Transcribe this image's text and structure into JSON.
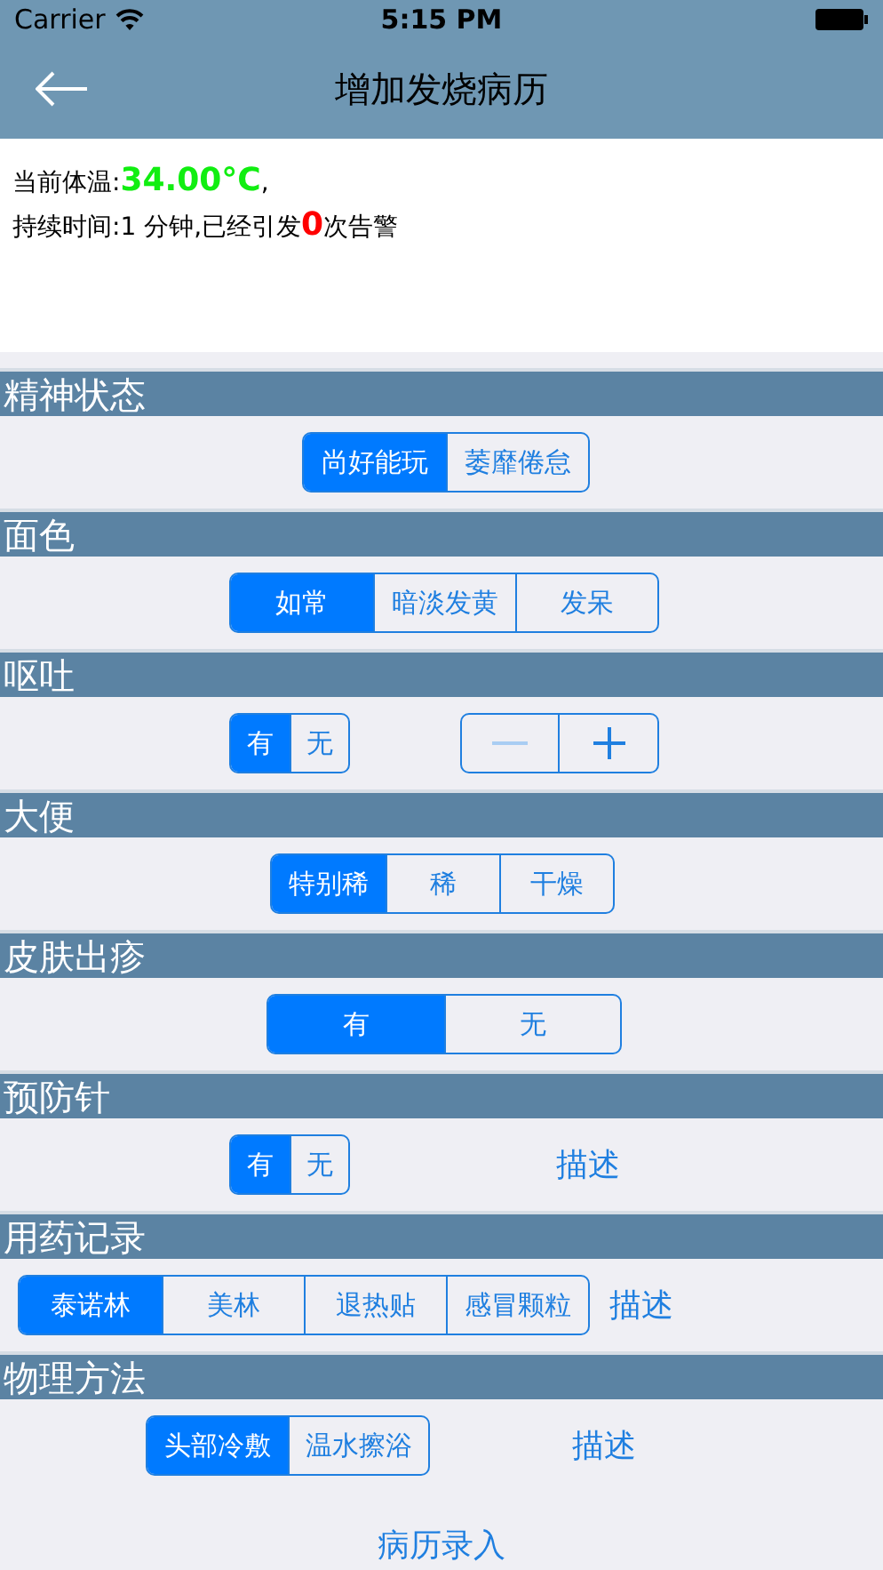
{
  "status_bar": {
    "carrier": "Carrier",
    "time": "5:15 PM"
  },
  "nav_bar": {
    "title": "增加发烧病历"
  },
  "info": {
    "temperature_label": "当前体温:",
    "temperature": "34.00°C",
    "temperature_suffix": ",",
    "duration_prefix": "持续时间:1 分钟,已经引发",
    "alarm_count": "0",
    "duration_suffix": "次告警"
  },
  "sections": [
    {
      "title": "精神状态",
      "controls": [
        {
          "kind": "segmented",
          "options": [
            {
              "label": "尚好能玩",
              "selected": true
            },
            {
              "label": "萎靡倦怠",
              "selected": false
            }
          ]
        }
      ]
    },
    {
      "title": "面色",
      "controls": [
        {
          "kind": "segmented",
          "options": [
            {
              "label": "如常",
              "selected": true
            },
            {
              "label": "暗淡发黄",
              "selected": false
            },
            {
              "label": "发呆",
              "selected": false
            }
          ]
        }
      ]
    },
    {
      "title": "呕吐",
      "controls": [
        {
          "kind": "segmented",
          "options": [
            {
              "label": "有",
              "selected": true
            },
            {
              "label": "无",
              "selected": false
            }
          ]
        },
        {
          "kind": "stepper",
          "decrement_disabled": true,
          "increment_disabled": false
        }
      ]
    },
    {
      "title": "大便",
      "controls": [
        {
          "kind": "segmented",
          "options": [
            {
              "label": "特别稀",
              "selected": true
            },
            {
              "label": "稀",
              "selected": false
            },
            {
              "label": "干燥",
              "selected": false
            }
          ]
        }
      ]
    },
    {
      "title": "皮肤出疹",
      "controls": [
        {
          "kind": "segmented",
          "options": [
            {
              "label": "有",
              "selected": true
            },
            {
              "label": "无",
              "selected": false
            }
          ]
        }
      ]
    },
    {
      "title": "预防针",
      "controls": [
        {
          "kind": "segmented",
          "options": [
            {
              "label": "有",
              "selected": true
            },
            {
              "label": "无",
              "selected": false
            }
          ]
        },
        {
          "kind": "link",
          "label": "描述"
        }
      ]
    },
    {
      "title": "用药记录",
      "controls": [
        {
          "kind": "segmented",
          "options": [
            {
              "label": "泰诺林",
              "selected": true
            },
            {
              "label": "美林",
              "selected": false
            },
            {
              "label": "退热贴",
              "selected": false
            },
            {
              "label": "感冒颗粒",
              "selected": false
            }
          ]
        },
        {
          "kind": "link",
          "label": "描述"
        }
      ]
    },
    {
      "title": "物理方法",
      "controls": [
        {
          "kind": "segmented",
          "options": [
            {
              "label": "头部冷敷",
              "selected": true
            },
            {
              "label": "温水擦浴",
              "selected": false
            }
          ]
        },
        {
          "kind": "link",
          "label": "描述"
        }
      ]
    }
  ],
  "submit_button": "病历录入"
}
